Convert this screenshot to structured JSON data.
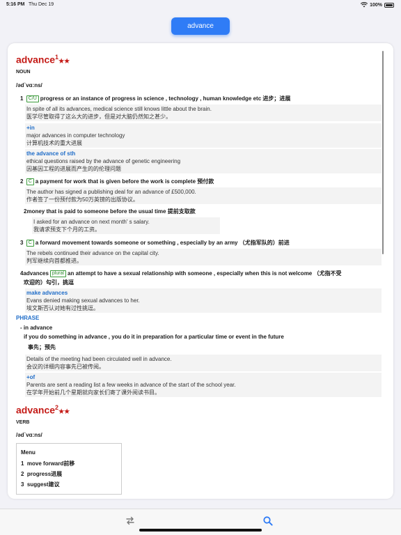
{
  "status": {
    "time": "5:16 PM",
    "date": "Thu Dec 19",
    "battery": "100%"
  },
  "search_word": "advance",
  "entry1": {
    "word": "advance",
    "sup": "1",
    "stars": "★★",
    "pos": "NOUN",
    "pron": "/əd`vɑ:ns/",
    "s1": {
      "num": "1",
      "badge": "C/U",
      "text": "progress or an instance of progress in science , technology , human knowledge etc 进步；进展"
    },
    "s1_ex1": {
      "en": "In spite of all its advances, medical science still knows little about the brain.",
      "zh": "医学尽管取得了这么大的进步，但是对大脑仍然知之甚少。"
    },
    "s1_ex2": {
      "coll": "+in",
      "en": "major advances in computer technology",
      "zh": "计算机技术的重大进展"
    },
    "s1_ex3": {
      "coll": "the advance of sth",
      "en": "ethical questions raised by the advance of genetic engineering",
      "zh": "因基因工程的进展而产生的的伦理问题"
    },
    "s2": {
      "num": "2",
      "badge": "C",
      "text": "a payment for work that is given before the work is complete 预付款"
    },
    "s2_ex1": {
      "en": "The author has signed a publishing deal for an advance of £500,000.",
      "zh": "作者签了一份预付款为50万英镑的出版协议。"
    },
    "s2b": {
      "num": "2",
      "text": "money that is paid to someone before the usual time 提前支取款"
    },
    "s2b_ex1": {
      "en": "I asked for an advance on next month' s salary.",
      "zh": "我请求预支下个月的工资。"
    },
    "s3": {
      "num": "3",
      "badge": "C",
      "text": "a forward movement towards someone or something , especially by an army （尤指军队的）前进"
    },
    "s3_ex1": {
      "en": "The rebels continued their advance on the capital city.",
      "zh": "判军继续向首都推进。"
    },
    "s4": {
      "num": "4",
      "lead": "advances",
      "badge": "plural",
      "text": "an attempt to have a sexual relationship with someone , especially when this is not welcome （尤指不受",
      "text2": "欢迎的）勾引，挑逗"
    },
    "s4_ex1": {
      "coll": "make advances",
      "en": "Evans denied making sexual advances to her.",
      "zh": "埃文斯否认对她有过性挑逗。"
    },
    "phrase_heading": "PHRASE",
    "phrase": {
      "title": "- in advance",
      "def": "if you do something in advance , you do it in preparation for a particular time or event in the future",
      "zh": "事先；预先"
    },
    "ph_ex1": {
      "en": "Details of the meeting had been circulated well in advance.",
      "zh": "会议的详细内容事先已被传阅。"
    },
    "ph_ex2": {
      "coll": "+of",
      "en": "Parents are sent a reading list a few weeks in advance of the start of the school year.",
      "zh": "在学年开始前几个星期就向家长们寄了课外阅读书目。"
    }
  },
  "entry2": {
    "word": "advance",
    "sup": "2",
    "stars": "★★",
    "pos": "VERB",
    "pron": "/əd`vɑ:ns/",
    "menu_title": "Menu",
    "menu": [
      {
        "num": "1",
        "text": "move forward前移"
      },
      {
        "num": "2",
        "text": "progress进展"
      },
      {
        "num": "3",
        "text": "suggest建议"
      }
    ]
  },
  "icons": {
    "swap": "swap-icon",
    "search": "search-icon"
  },
  "colors": {
    "accent": "#2f7cf6",
    "headword": "#c41a16",
    "collocation": "#1e6cc8",
    "badge": "#2c8a2c"
  }
}
